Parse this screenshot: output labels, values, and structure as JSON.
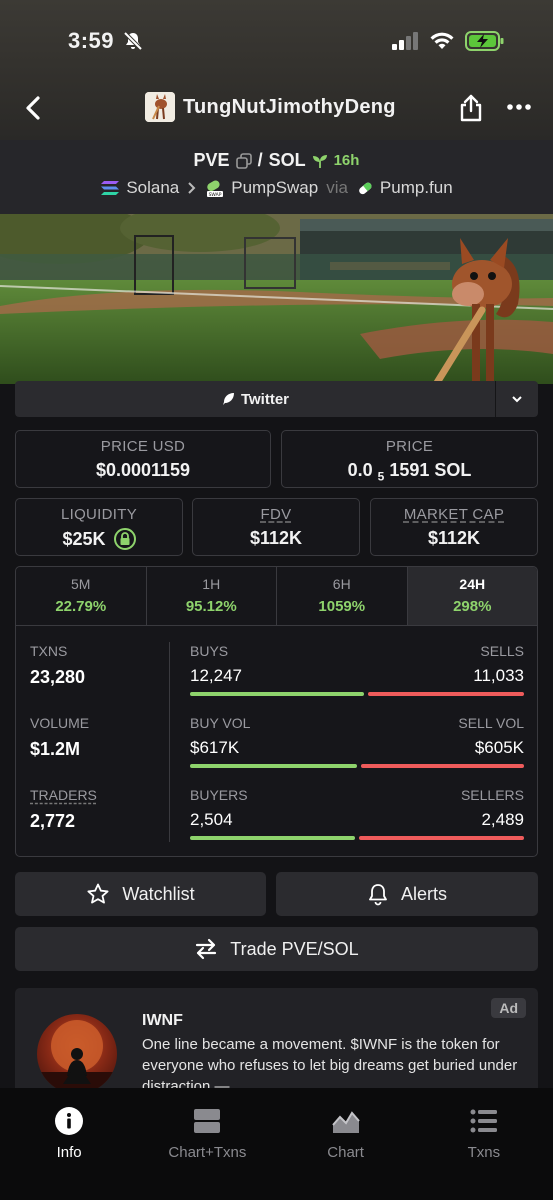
{
  "status": {
    "time": "3:59"
  },
  "header": {
    "token_name": "TungNutJimothyDeng"
  },
  "pair": {
    "base": "PVE",
    "separator": "/",
    "quote": "SOL",
    "age": "16h",
    "chain": "Solana",
    "dex": "PumpSwap",
    "via": "via",
    "launchpad": "Pump.fun"
  },
  "social": {
    "twitter_label": "Twitter"
  },
  "price": {
    "usd_label": "PRICE USD",
    "usd_value": "$0.0001159",
    "native_label": "PRICE",
    "native_prefix": "0.0",
    "native_zeros": "5",
    "native_digits": "1591 SOL"
  },
  "metrics": {
    "liquidity_label": "LIQUIDITY",
    "liquidity_value": "$25K",
    "fdv_label": "FDV",
    "fdv_value": "$112K",
    "mcap_label": "MARKET CAP",
    "mcap_value": "$112K"
  },
  "periods": [
    {
      "name": "5M",
      "change": "22.79%"
    },
    {
      "name": "1H",
      "change": "95.12%"
    },
    {
      "name": "6H",
      "change": "1059%"
    },
    {
      "name": "24H",
      "change": "298%"
    }
  ],
  "stats": {
    "txns_label": "TXNS",
    "txns_value": "23,280",
    "volume_label": "VOLUME",
    "volume_value": "$1.2M",
    "traders_label": "TRADERS",
    "traders_value": "2,772",
    "buys_label": "BUYS",
    "buys_value": "12,247",
    "sells_label": "SELLS",
    "sells_value": "11,033",
    "buyvol_label": "BUY VOL",
    "buyvol_value": "$617K",
    "sellvol_label": "SELL VOL",
    "sellvol_value": "$605K",
    "buyers_label": "BUYERS",
    "buyers_value": "2,504",
    "sellers_label": "SELLERS",
    "sellers_value": "2,489",
    "buys_share": 0.526,
    "buyvol_share": 0.505,
    "buyers_share": 0.501
  },
  "actions": {
    "watchlist": "Watchlist",
    "alerts": "Alerts",
    "trade": "Trade PVE/SOL"
  },
  "ad": {
    "badge": "Ad",
    "title": "IWNF",
    "text": "One line became a movement. $IWNF is the token for everyone who refuses to let big dreams get buried under distraction —"
  },
  "bottom_nav": [
    {
      "label": "Info",
      "icon": "info-icon",
      "active": true
    },
    {
      "label": "Chart+Txns",
      "icon": "chart-txns-icon",
      "active": false
    },
    {
      "label": "Chart",
      "icon": "chart-icon",
      "active": false
    },
    {
      "label": "Txns",
      "icon": "list-icon",
      "active": false
    }
  ],
  "colors": {
    "positive": "#8ed36c",
    "negative": "#ef5b5b",
    "background": "#131316"
  }
}
